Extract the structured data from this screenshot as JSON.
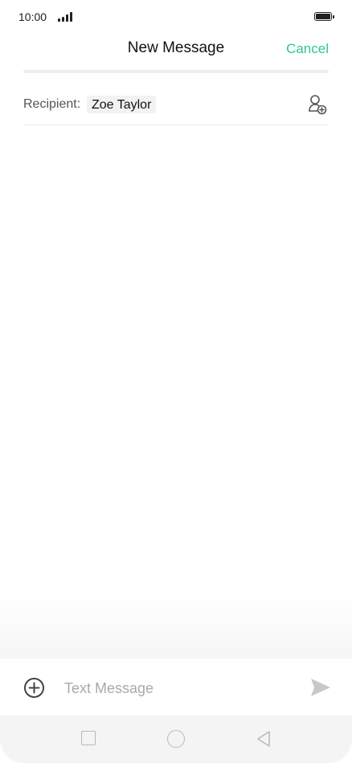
{
  "status_bar": {
    "time": "10:00",
    "signal_icon": "signal-bars-icon",
    "battery_icon": "battery-icon",
    "battery_level": 0.9
  },
  "header": {
    "title": "New Message",
    "cancel_label": "Cancel"
  },
  "recipient": {
    "label": "Recipient:",
    "name": "Zoe Taylor",
    "add_icon": "add-contact-icon"
  },
  "composer": {
    "placeholder": "Text Message",
    "value": "",
    "attach_icon": "plus-circle-icon",
    "send_icon": "send-icon"
  },
  "nav_bar": {
    "recents_icon": "square-icon",
    "home_icon": "circle-icon",
    "back_icon": "triangle-back-icon"
  },
  "colors": {
    "accent": "#2dc78b",
    "text": "#111111",
    "muted": "#a9a9a9",
    "icon": "#555555"
  }
}
